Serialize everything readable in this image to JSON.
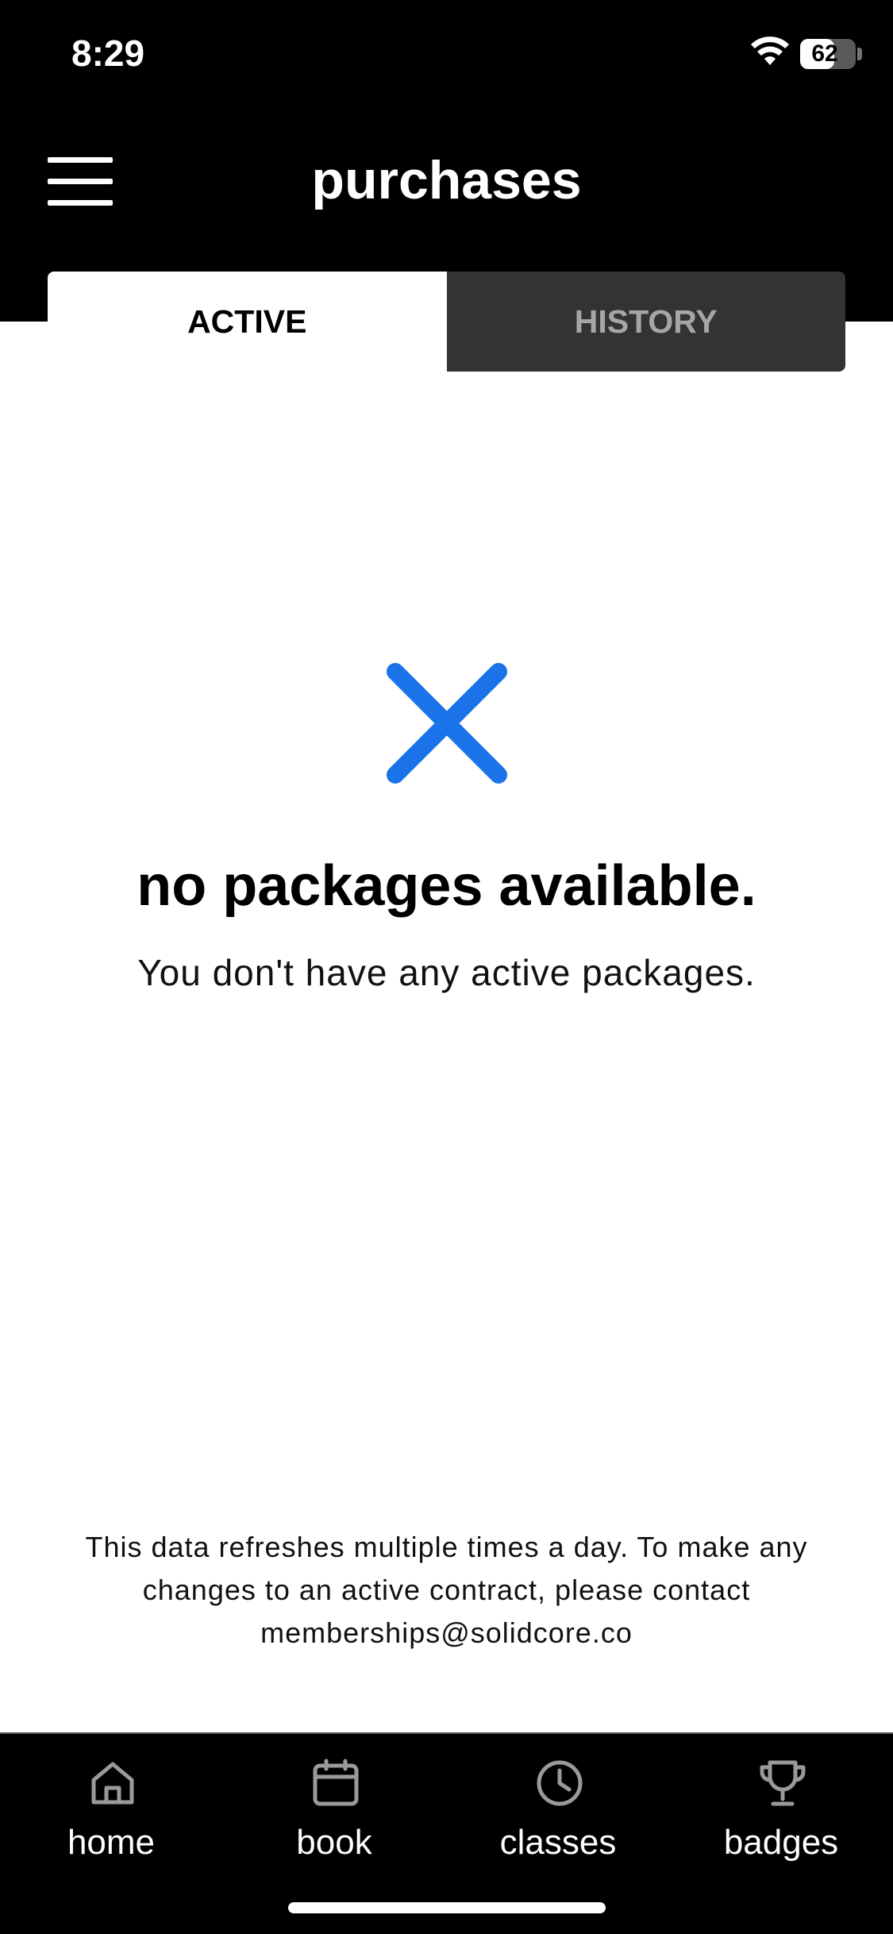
{
  "status_bar": {
    "time": "8:29",
    "battery": "62",
    "battery_level": 0.62
  },
  "header": {
    "title": "purchases",
    "menu_icon": "hamburger-menu-icon"
  },
  "tabs": [
    {
      "label": "ACTIVE",
      "selected": true
    },
    {
      "label": "HISTORY",
      "selected": false
    }
  ],
  "empty_state": {
    "icon": "x-icon",
    "title": "no packages available.",
    "subtitle": "You don't have any active packages."
  },
  "footer_note": {
    "line1": "This data refreshes multiple times a day. To make any",
    "line2": "changes to an active contract, please contact",
    "line3": "memberships@solidcore.co"
  },
  "bottom_nav": [
    {
      "label": "home",
      "icon": "home-icon"
    },
    {
      "label": "book",
      "icon": "calendar-icon"
    },
    {
      "label": "classes",
      "icon": "clock-icon"
    },
    {
      "label": "badges",
      "icon": "trophy-icon"
    }
  ],
  "colors": {
    "accent": "#1a73e8",
    "header_bg": "#000000",
    "inactive_tab_bg": "#333333",
    "inactive_tab_text": "#a6a6a6"
  }
}
